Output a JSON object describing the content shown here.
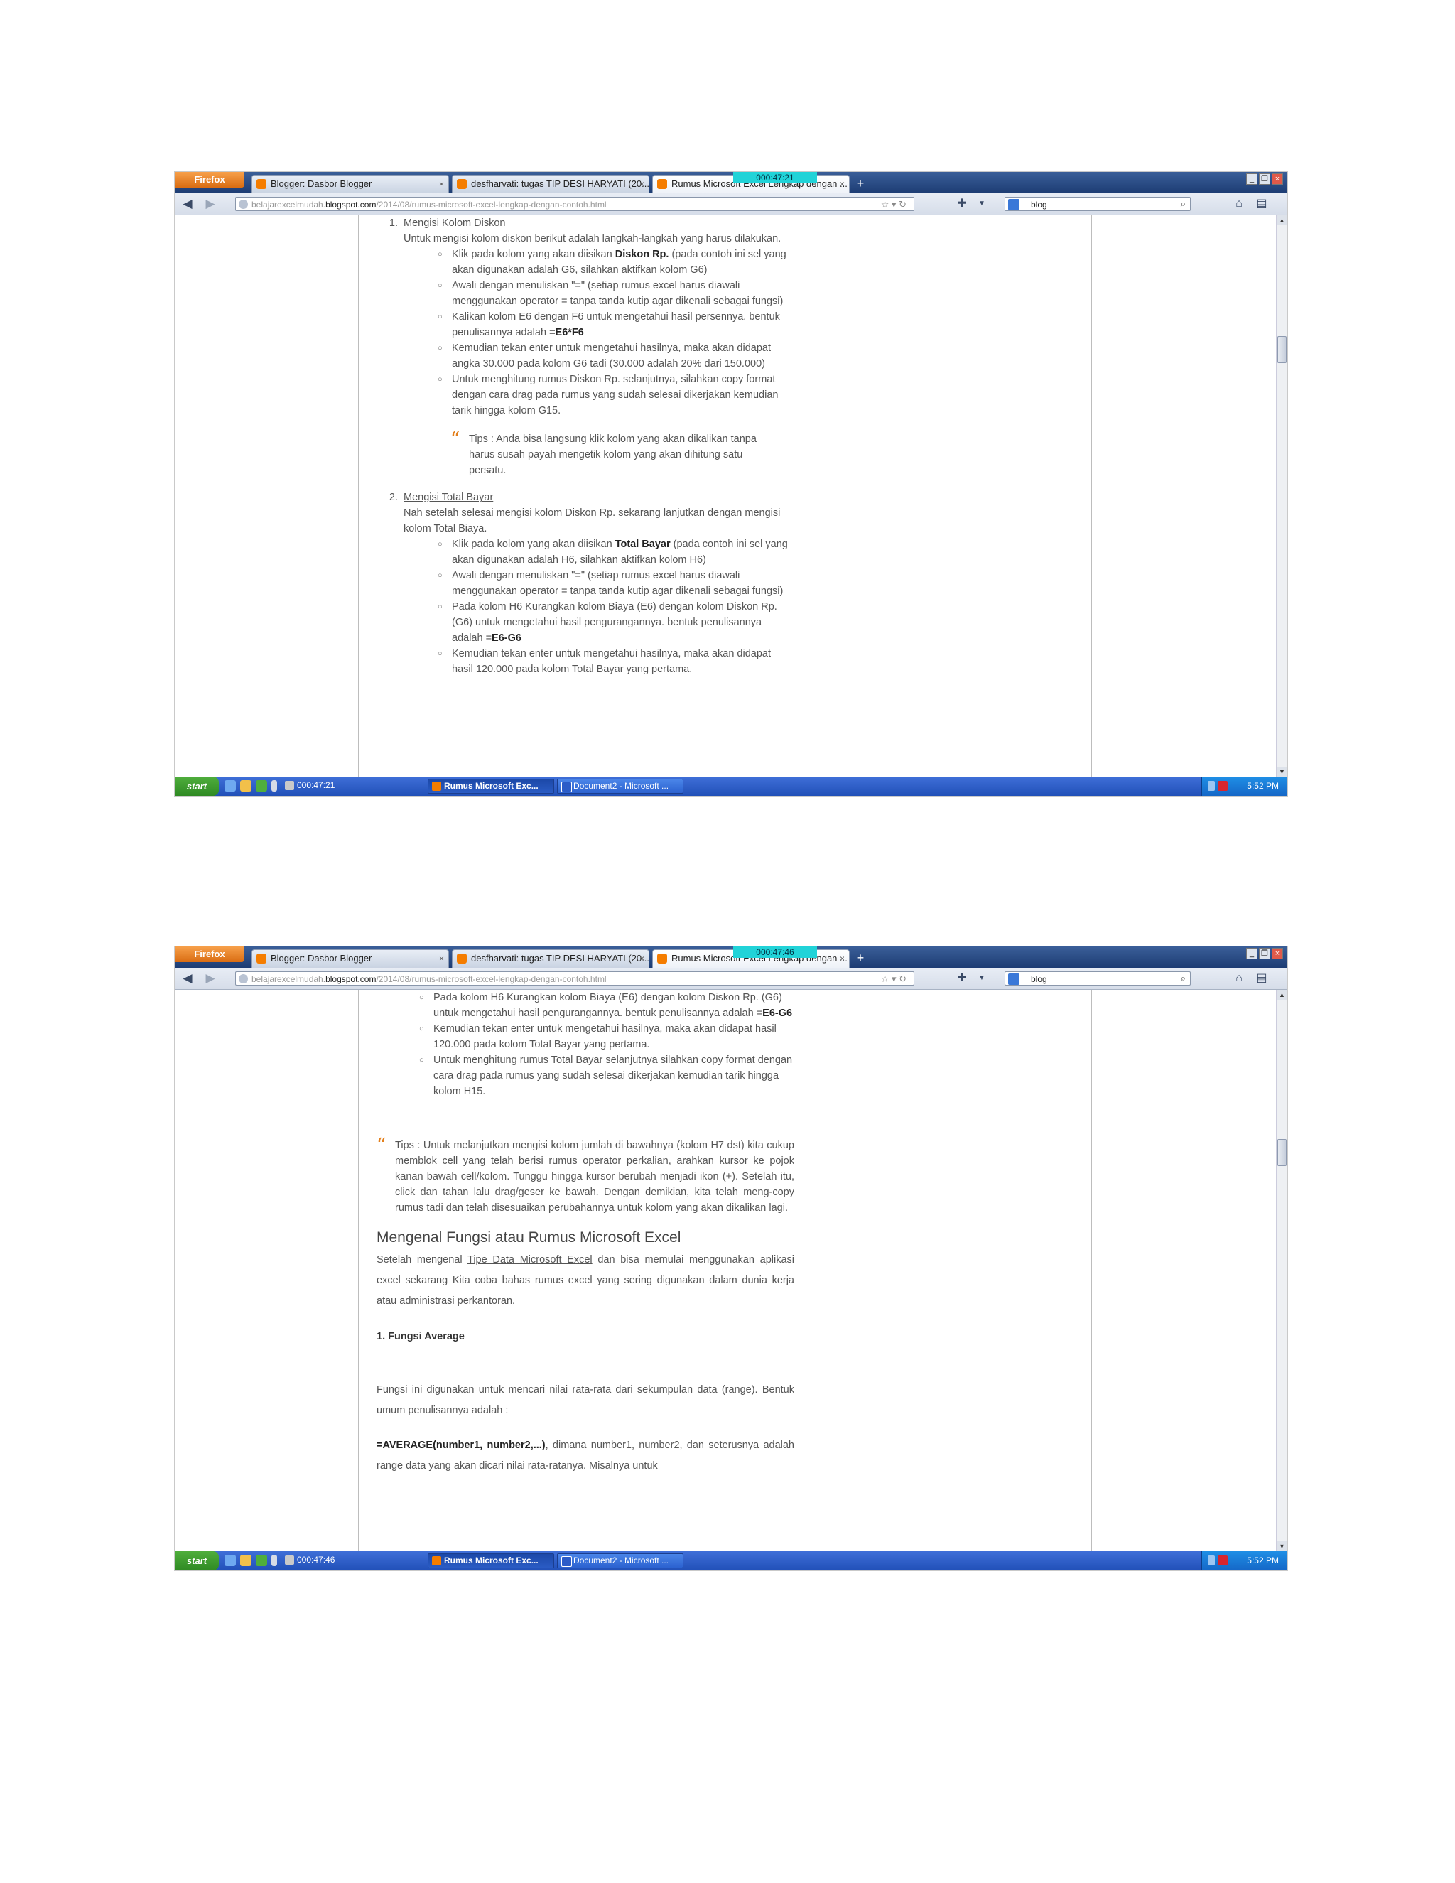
{
  "shot1": {
    "browser_button": "Firefox",
    "tabs": [
      {
        "title": "Blogger: Dasbor Blogger"
      },
      {
        "title": "desfharvati: tugas TIP DESI HARYATI (20..."
      },
      {
        "title": "Rumus Microsoft Excel Lengkap dengan ..."
      }
    ],
    "timer": "000:47:21",
    "url_prefix": "belajarexcelmudah.",
    "url_domain": "blogspot.com",
    "url_path": "/2014/08/rumus-microsoft-excel-lengkap-dengan-contoh.html",
    "search_value": "blog",
    "article": {
      "item1_title": "Mengisi Kolom Diskon",
      "item1_intro": "Untuk mengisi kolom diskon berikut adalah langkah-langkah yang harus dilakukan.",
      "item1_steps": [
        {
          "pre": "Klik pada kolom yang akan diisikan ",
          "bold": "Diskon Rp.",
          "post": " (pada contoh ini sel yang akan digunakan adalah G6, silahkan aktifkan kolom G6)"
        },
        {
          "pre": "Awali dengan menuliskan \"=\" (setiap rumus excel harus diawali menggunakan operator = tanpa tanda kutip agar dikenali sebagai fungsi)",
          "bold": "",
          "post": ""
        },
        {
          "pre": "Kalikan kolom E6 dengan F6 untuk mengetahui hasil persennya. bentuk penulisannya adalah ",
          "bold": "=E6*F6",
          "post": ""
        },
        {
          "pre": "Kemudian tekan enter untuk mengetahui hasilnya, maka akan didapat angka 30.000 pada kolom G6 tadi (30.000 adalah 20% dari 150.000)",
          "bold": "",
          "post": ""
        },
        {
          "pre": "Untuk menghitung rumus Diskon Rp. selanjutnya, silahkan copy format dengan cara drag pada rumus yang sudah selesai dikerjakan kemudian tarik hingga kolom G15.",
          "bold": "",
          "post": ""
        }
      ],
      "tips": "Tips : Anda bisa langsung klik kolom yang akan dikalikan tanpa harus susah payah mengetik kolom yang akan dihitung satu persatu.",
      "item2_title": "Mengisi Total Bayar",
      "item2_intro": "Nah setelah selesai mengisi kolom Diskon Rp. sekarang lanjutkan dengan mengisi kolom Total Biaya.",
      "item2_steps": [
        {
          "pre": "Klik pada kolom yang akan diisikan ",
          "bold": "Total Bayar",
          "post": " (pada contoh ini sel yang akan digunakan adalah H6, silahkan aktifkan kolom H6)"
        },
        {
          "pre": "Awali dengan menuliskan \"=\" (setiap rumus excel harus diawali menggunakan operator = tanpa tanda kutip agar dikenali sebagai fungsi)",
          "bold": "",
          "post": ""
        },
        {
          "pre": "Pada kolom H6 Kurangkan kolom Biaya (E6) dengan kolom Diskon Rp. (G6) untuk mengetahui hasil pengurangannya. bentuk penulisannya adalah =",
          "bold": "E6-G6",
          "post": ""
        },
        {
          "pre": "Kemudian tekan enter untuk mengetahui hasilnya, maka akan didapat hasil 120.000 pada kolom Total Bayar yang pertama.",
          "bold": "",
          "post": ""
        }
      ]
    },
    "taskbar": {
      "start": "start",
      "timer_task": "000:47:21",
      "task1": "Rumus Microsoft Exc...",
      "task2": "Document2 - Microsoft ...",
      "clock": "5:52 PM"
    }
  },
  "shot2": {
    "browser_button": "Firefox",
    "tabs": [
      {
        "title": "Blogger: Dasbor Blogger"
      },
      {
        "title": "desfharvati: tugas TIP DESI HARYATI (20..."
      },
      {
        "title": "Rumus Microsoft Excel Lengkap dengan ..."
      }
    ],
    "timer": "000:47:46",
    "url_prefix": "belajarexcelmudah.",
    "url_domain": "blogspot.com",
    "url_path": "/2014/08/rumus-microsoft-excel-lengkap-dengan-contoh.html",
    "search_value": "blog",
    "article": {
      "steps": [
        {
          "pre": "Pada kolom H6 Kurangkan kolom Biaya (E6) dengan kolom Diskon Rp. (G6) untuk mengetahui hasil pengurangannya. bentuk penulisannya adalah =",
          "bold": "E6-G6",
          "post": ""
        },
        {
          "pre": "Kemudian tekan enter untuk mengetahui hasilnya, maka akan didapat hasil 120.000 pada kolom Total Bayar yang pertama.",
          "bold": "",
          "post": ""
        },
        {
          "pre": "Untuk menghitung rumus Total Bayar selanjutnya silahkan copy format dengan cara drag pada rumus yang sudah selesai dikerjakan kemudian tarik hingga kolom H15.",
          "bold": "",
          "post": ""
        }
      ],
      "tips": "Tips : Untuk melanjutkan mengisi kolom jumlah di bawahnya (kolom H7 dst) kita cukup memblok cell yang telah berisi rumus operator perkalian, arahkan kursor ke pojok kanan bawah cell/kolom. Tunggu hingga kursor berubah menjadi ikon (+). Setelah itu, click dan tahan lalu drag/geser ke bawah. Dengan demikian, kita telah meng-copy rumus tadi dan telah disesuaikan perubahannya untuk kolom yang akan dikalikan lagi.",
      "section_title": "Mengenal Fungsi atau Rumus Microsoft Excel",
      "section_p_pre": "Setelah mengenal ",
      "section_p_link": "Tipe Data Microsoft Excel",
      "section_p_post": " dan bisa memulai menggunakan aplikasi excel sekarang Kita coba bahas rumus excel yang sering digunakan dalam dunia kerja atau administrasi perkantoran.",
      "subheading": "1. Fungsi Average",
      "p_average": "Fungsi ini digunakan untuk mencari nilai rata-rata dari sekumpulan data (range). Bentuk umum penulisannya adalah :",
      "formula_bold": "=AVERAGE(number1, number2,...)",
      "formula_rest": ", dimana number1, number2, dan seterusnya adalah range data yang akan dicari nilai rata-ratanya. Misalnya untuk"
    },
    "taskbar": {
      "start": "start",
      "timer_task": "000:47:46",
      "task1": "Rumus Microsoft Exc...",
      "task2": "Document2 - Microsoft ...",
      "clock": "5:52 PM"
    }
  }
}
